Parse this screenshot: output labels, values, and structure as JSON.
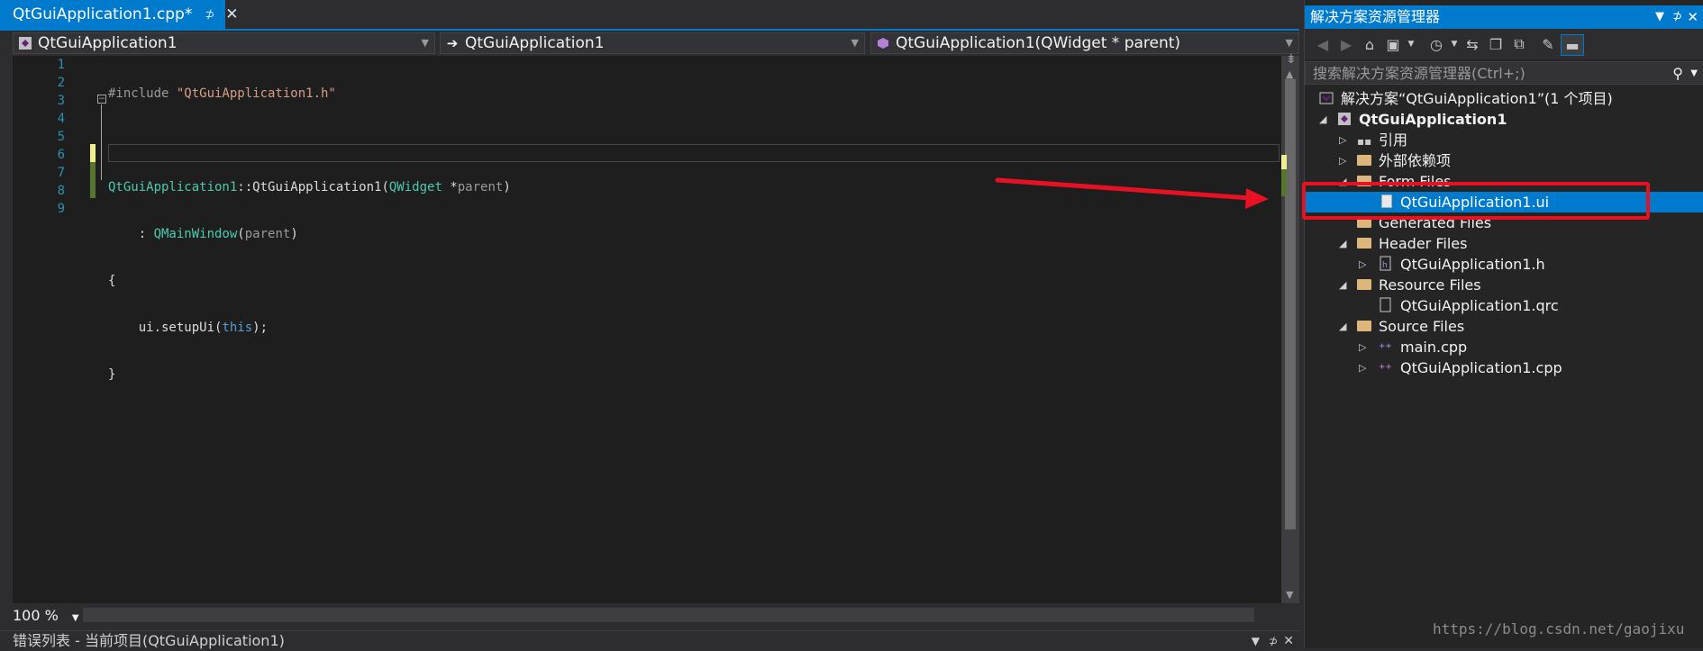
{
  "editor": {
    "tab": {
      "label": "QtGuiApplication1.cpp*",
      "pin": "⊅",
      "close": "✕"
    },
    "nav": {
      "project": "QtGuiApplication1",
      "scope": "QtGuiApplication1",
      "member": "QtGuiApplication1(QWidget * parent)"
    },
    "line_numbers": [
      "1",
      "2",
      "3",
      "4",
      "5",
      "6",
      "7",
      "8",
      "9"
    ],
    "code": {
      "l1_pre": "#include ",
      "l1_str": "\"QtGuiApplication1.h\"",
      "l3_a": "QtGuiApplication1",
      "l3_b": "::QtGuiApplication1(",
      "l3_c": "QWidget",
      "l3_d": " *",
      "l3_e": "parent",
      "l3_f": ")",
      "l4_a": "    : ",
      "l4_b": "QMainWindow",
      "l4_c": "(",
      "l4_d": "parent",
      "l4_e": ")",
      "l5": "{",
      "l6_a": "    ui.setupUi(",
      "l6_b": "this",
      "l6_c": ");",
      "l7": "}"
    },
    "zoom": "100 %",
    "error_list": "错误列表 - 当前项目(QtGuiApplication1)"
  },
  "solution_explorer": {
    "title": "解决方案资源管理器",
    "search_placeholder": "搜索解决方案资源管理器(Ctrl+;)",
    "items": [
      {
        "label": "解决方案“QtGuiApplication1”(1 个项目)"
      },
      {
        "label": "QtGuiApplication1"
      },
      {
        "label": "引用"
      },
      {
        "label": "外部依赖项"
      },
      {
        "label": "Form Files"
      },
      {
        "label": "QtGuiApplication1.ui"
      },
      {
        "label": "Generated Files"
      },
      {
        "label": "Header Files"
      },
      {
        "label": "QtGuiApplication1.h"
      },
      {
        "label": "Resource Files"
      },
      {
        "label": "QtGuiApplication1.qrc"
      },
      {
        "label": "Source Files"
      },
      {
        "label": "main.cpp"
      },
      {
        "label": "QtGuiApplication1.cpp"
      }
    ]
  },
  "watermark": "https://blog.csdn.net/gaojixu",
  "colors": {
    "accent": "#007acc",
    "annotation": "#e81123"
  }
}
